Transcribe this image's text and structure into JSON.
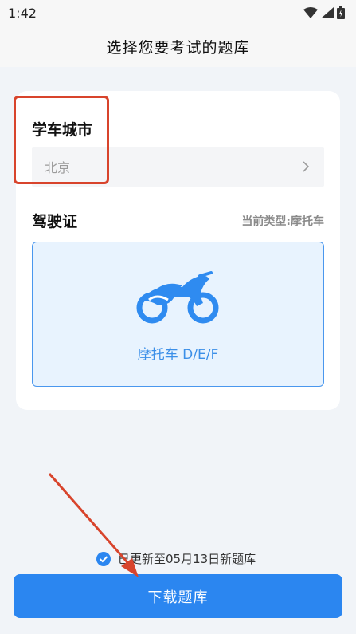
{
  "status_bar": {
    "time": "1:42"
  },
  "header": {
    "title": "选择您要考试的题库"
  },
  "city_section": {
    "title": "学车城市",
    "value": "北京"
  },
  "license_section": {
    "title": "驾驶证",
    "current_type": "当前类型:摩托车",
    "option_label": "摩托车 D/E/F",
    "option_icon": "motorcycle-icon"
  },
  "update_notice": {
    "text": "已更新至05月13日新题库"
  },
  "download_button": {
    "label": "下载题库"
  },
  "colors": {
    "accent": "#2b86f0",
    "highlight": "#d8442c",
    "option_bg": "#e8f3fe",
    "option_border": "#4a97ee"
  }
}
